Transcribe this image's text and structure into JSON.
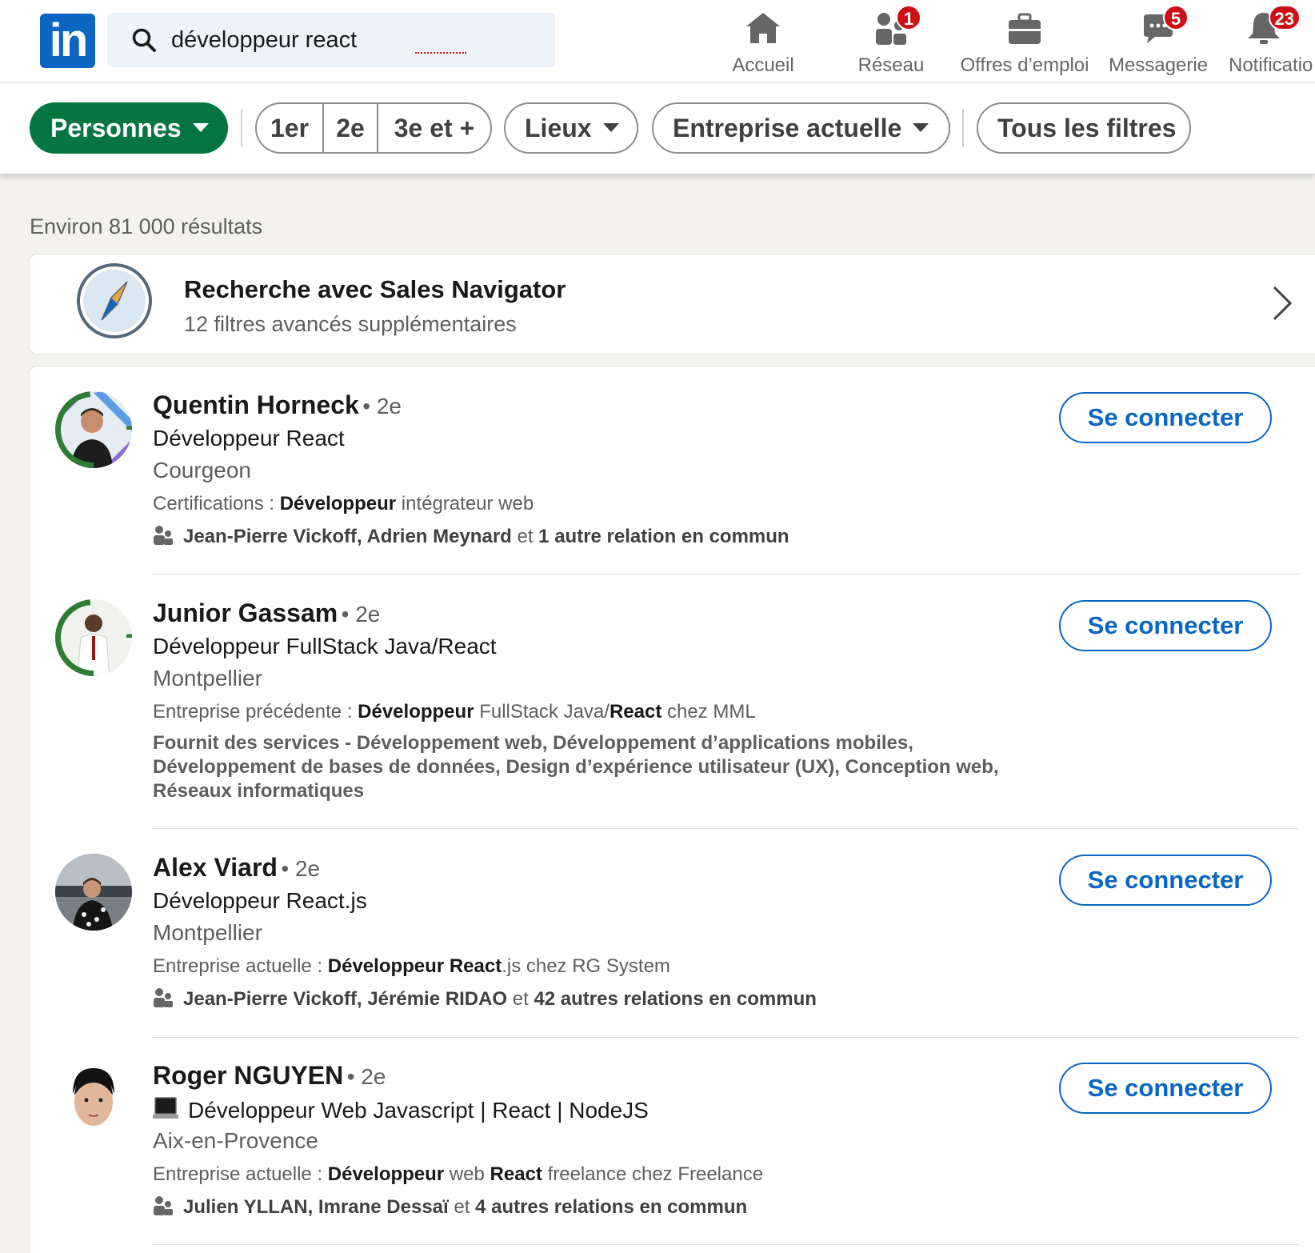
{
  "nav": {
    "logo": "in",
    "search_value": "développeur react",
    "items": [
      {
        "label": "Accueil",
        "badge": ""
      },
      {
        "label": "Réseau",
        "badge": "1"
      },
      {
        "label": "Offres d’emploi",
        "badge": ""
      },
      {
        "label": "Messagerie",
        "badge": "5"
      },
      {
        "label": "Notificatio",
        "badge": "23"
      }
    ]
  },
  "filters": {
    "people": "Personnes",
    "degrees": [
      "1er",
      "2e",
      "3e et +"
    ],
    "locations": "Lieux",
    "company": "Entreprise actuelle",
    "all": "Tous les filtres"
  },
  "results_count": "Environ 81 000 résultats",
  "sales_nav": {
    "title": "Recherche avec Sales Navigator",
    "subtitle": "12 filtres avancés supplémentaires"
  },
  "connect_label": "Se connecter",
  "results": [
    {
      "name": "Quentin Horneck",
      "degree": "• 2e",
      "title": "Développeur React",
      "location": "Courgeon",
      "info_label": "Certifications : ",
      "info_bold1": "Développeur",
      "info_rest1": " intégrateur web",
      "mutual_names": "Jean-Pierre Vickoff, Adrien Meynard",
      "mutual_and": " et ",
      "mutual_count": "1 autre relation en commun"
    },
    {
      "name": "Junior Gassam",
      "degree": "• 2e",
      "title": "Développeur FullStack Java/React",
      "location": "Montpellier",
      "info_label": "Entreprise précédente  : ",
      "info_bold1": "Développeur",
      "info_rest1": " FullStack Java/",
      "info_bold2": "React",
      "info_rest2": " chez MML",
      "services": "Fournit des services - Développement web, Développement d’applications mobiles, Développement de bases de données, Design d’expérience utilisateur (UX), Conception web, Réseaux informatiques"
    },
    {
      "name": "Alex Viard",
      "degree": "• 2e",
      "title": "Développeur React.js",
      "location": "Montpellier",
      "info_label": "Entreprise actuelle  : ",
      "info_bold1": "Développeur React",
      "info_rest1": ".js chez RG System",
      "mutual_names": "Jean-Pierre Vickoff, Jérémie RIDAO",
      "mutual_and": " et ",
      "mutual_count": "42 autres relations en commun"
    },
    {
      "name": "Roger NGUYEN",
      "degree": "• 2e",
      "title": "Développeur Web Javascript | React | NodeJS",
      "location": "Aix-en-Provence",
      "info_label": "Entreprise actuelle  : ",
      "info_bold1": "Développeur",
      "info_rest1": " web ",
      "info_bold2": "React",
      "info_rest2": " freelance chez Freelance",
      "mutual_names": "Julien YLLAN, Imrane Dessaï",
      "mutual_and": " et ",
      "mutual_count": "4 autres relations en commun"
    }
  ]
}
